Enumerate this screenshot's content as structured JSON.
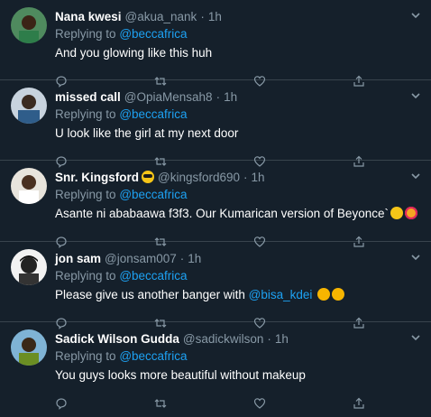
{
  "tweets": [
    {
      "name": "Nana kwesi",
      "handle": "@akua_nank",
      "time": "1h",
      "reply_prefix": "Replying to",
      "reply_to": "@beccafrica",
      "text": "And you glowing like this huh"
    },
    {
      "name": "missed call",
      "handle": "@OpiaMensah8",
      "time": "1h",
      "reply_prefix": "Replying to",
      "reply_to": "@beccafrica",
      "text": "U look like the girl at my next door"
    },
    {
      "name": "Snr. Kingsford",
      "handle": "@kingsford690",
      "time": "1h",
      "reply_prefix": "Replying to",
      "reply_to": "@beccafrica",
      "text": "Asante ni ababaawa f3f3. Our Kumarican version of Beyonce`"
    },
    {
      "name": "jon sam",
      "handle": "@jonsam007",
      "time": "1h",
      "reply_prefix": "Replying to",
      "reply_to": "@beccafrica",
      "text_before": "Please give us another banger with ",
      "mention": "@bisa_kdei"
    },
    {
      "name": "Sadick Wilson Gudda",
      "handle": "@sadickwilson",
      "time": "1h",
      "reply_prefix": "Replying to",
      "reply_to": "@beccafrica",
      "text": "You guys looks more beautiful without makeup"
    }
  ],
  "separator": "·",
  "colors": {
    "background": "#15202b",
    "divider": "#38444d",
    "muted": "#8899a6",
    "link": "#1da1f2"
  },
  "icons": [
    "chevron-down-icon",
    "reply-icon",
    "retweet-icon",
    "like-icon",
    "share-icon"
  ]
}
